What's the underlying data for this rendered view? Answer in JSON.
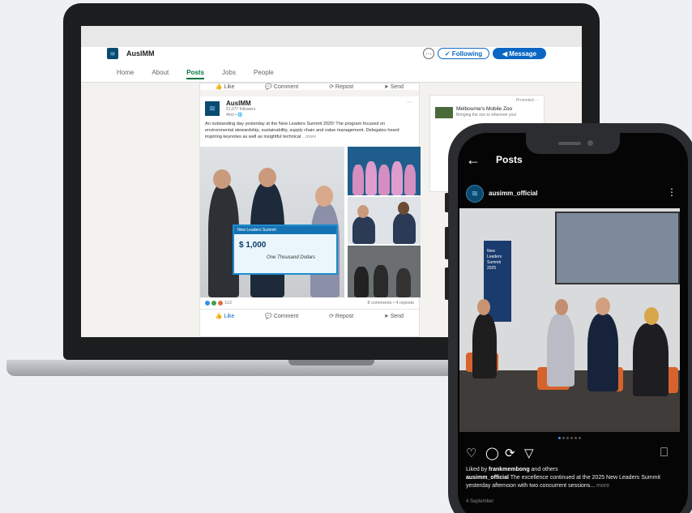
{
  "linkedin": {
    "company": "AusIMM",
    "more_label": "···",
    "following_label": "✓ Following",
    "message_label": "◀ Message",
    "nav": [
      "Home",
      "About",
      "Posts",
      "Jobs",
      "People"
    ],
    "action_bar": {
      "like": "Like",
      "comment": "Comment",
      "repost": "Repost",
      "send": "Send"
    },
    "post": {
      "name": "AusIMM",
      "followers": "51,077 followers",
      "time": "4mo • 🌐",
      "text": "An outstanding day yesterday at the New Leaders Summit 2025! The program focused on environmental stewardship, sustainability, supply chain and value management. Delegates heard inspiring keynotes as well as insightful technical",
      "more": "...more",
      "reaction_count": "113",
      "comments_reposts": "8 comments • 4 reposts",
      "cheque_header": "New Leaders Summit",
      "cheque_amount": "$ 1,000",
      "cheque_words": "One Thousand Dollars"
    },
    "ad": {
      "promoted": "Promoted ···",
      "title": "Melbourne's Mobile Zoo",
      "subtitle": "Bringing the zoo to wherever you!"
    }
  },
  "instagram": {
    "header_title": "Posts",
    "username": "ausimm_official",
    "banner_text": "New Leaders Summit 2025",
    "liked_by_prefix": "Liked by ",
    "liked_by_user": "frankmembong",
    "liked_by_suffix": " and others",
    "caption_user": "ausimm_official",
    "caption_text": " The excellence continued at the 2025 New Leaders Summit yesterday afternoon with two concurrent sessions...",
    "caption_more": " more",
    "date": "4 September"
  },
  "colors": {
    "linkedin_blue": "#0a66c2",
    "linkedin_green": "#057642",
    "ausimm_navy": "#0b4a6f",
    "instagram_dot": "#3897f0"
  },
  "icons": [
    "like-icon",
    "comment-icon",
    "repost-icon",
    "send-icon",
    "back-arrow-icon",
    "heart-icon",
    "bubble-icon",
    "share-icon",
    "bookmark-icon",
    "kebab-menu-icon"
  ]
}
